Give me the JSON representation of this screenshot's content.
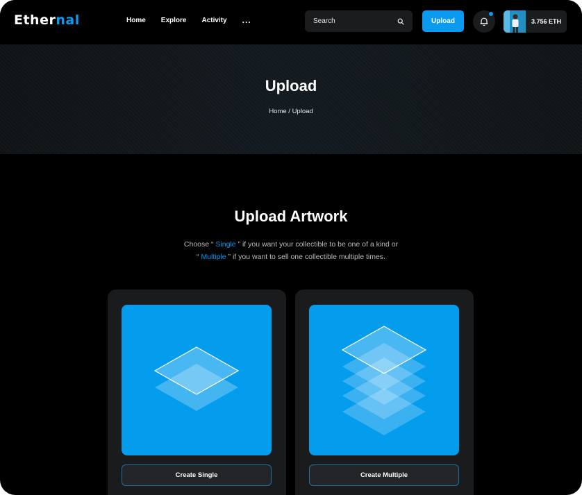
{
  "header": {
    "logo_main": "Ether",
    "logo_accent": "nal",
    "nav": [
      "Home",
      "Explore",
      "Activity",
      "..."
    ],
    "search_placeholder": "Search",
    "upload_label": "Upload",
    "balance": "3.756 ETH"
  },
  "hero": {
    "title": "Upload",
    "breadcrumb": "Home / Upload"
  },
  "main": {
    "title": "Upload Artwork",
    "desc_line1_pre": "Choose “ ",
    "desc_single": "Single",
    "desc_line1_post": " ” if you want your collectible to be one of a kind or",
    "desc_line2_pre": "“ ",
    "desc_multiple": "Multiple",
    "desc_line2_post": " ” if you want to sell one collectible multiple times."
  },
  "cards": {
    "single_label": "Create Single",
    "multiple_label": "Create Multiple"
  },
  "colors": {
    "accent": "#0a9af0",
    "card_art": "#049ced",
    "background": "#000000"
  },
  "icons": {
    "search": "search-icon",
    "bell": "bell-icon",
    "single_art": "single-layer-icon",
    "multiple_art": "multiple-layers-icon"
  }
}
